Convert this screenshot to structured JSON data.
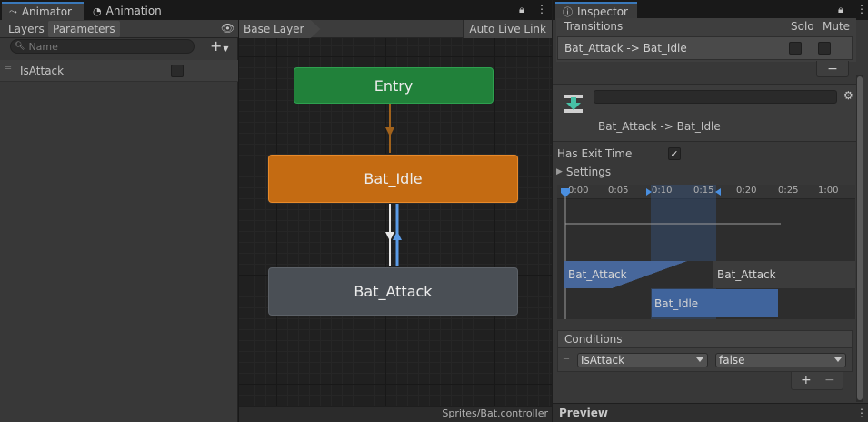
{
  "tabs": {
    "animator": "Animator",
    "animation": "Animation",
    "inspector": "Inspector"
  },
  "left_panel": {
    "tab_layers": "Layers",
    "tab_parameters": "Parameters",
    "search_placeholder": "Name",
    "add_label": "+",
    "parameters": [
      {
        "name": "IsAttack",
        "value": false
      }
    ]
  },
  "graph": {
    "breadcrumb": "Base Layer",
    "auto_live_link": "Auto Live Link",
    "states": {
      "entry": "Entry",
      "idle": "Bat_Idle",
      "attack": "Bat_Attack"
    },
    "asset_path": "Sprites/Bat.controller"
  },
  "inspector": {
    "transitions_header": "Transitions",
    "solo_label": "Solo",
    "mute_label": "Mute",
    "transition_row": "Bat_Attack -> Bat_Idle",
    "minus_label": "−",
    "name_value": "",
    "transition_title": "Bat_Attack -> Bat_Idle",
    "has_exit_time_label": "Has Exit Time",
    "has_exit_time_value": "✓",
    "settings_label": "Settings",
    "timeline": {
      "ticks": [
        "0:00",
        "0:05",
        "0:10",
        "0:15",
        "0:20",
        "0:25",
        "1:00"
      ],
      "source_bar": "Bat_Attack",
      "source_bar_next": "Bat_Attack",
      "dest_bar": "Bat_Idle"
    },
    "conditions_header": "Conditions",
    "condition": {
      "parameter": "IsAttack",
      "value": "false"
    },
    "plus_label": "+",
    "minus2_label": "−",
    "preview_label": "Preview"
  },
  "colors": {
    "entry_node": "#21813a",
    "idle_node": "#c46b12",
    "attack_node": "#4a4f55",
    "accent": "#3a79bb",
    "transition_arrow_up": "#5b9be6",
    "entry_arrow": "#a0621c"
  }
}
